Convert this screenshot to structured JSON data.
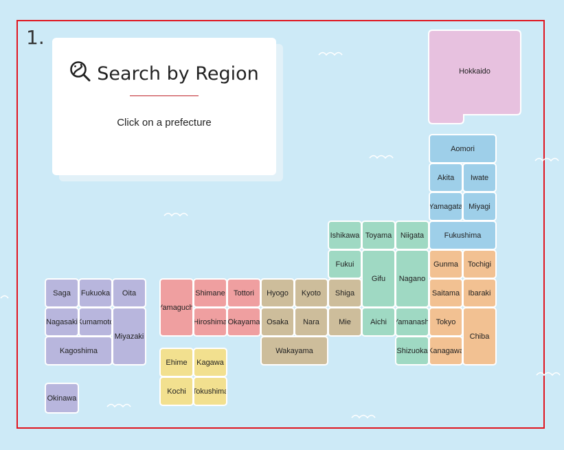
{
  "step_label": "1.",
  "card": {
    "title": "Search by Region",
    "subtitle": "Click on a prefecture",
    "icon": "magnifier-japan-icon"
  },
  "colors": {
    "sea": "#cdeaf7",
    "frame": "#e0141e",
    "hokkaido": "#e7c1df",
    "tohoku": "#9ecfe9",
    "chubu": "#9fd9c3",
    "kanto": "#f2c192",
    "kinki": "#cdbd9b",
    "chugoku": "#ef9fa0",
    "shikoku": "#f2e08f",
    "kyushu": "#b8b6dd"
  },
  "prefectures": {
    "hokkaido": "Hokkaido",
    "aomori": "Aomori",
    "akita": "Akita",
    "iwate": "Iwate",
    "yamagata": "Yamagata",
    "miyagi": "Miyagi",
    "fukushima": "Fukushima",
    "ishikawa": "Ishikawa",
    "toyama": "Toyama",
    "niigata": "Niigata",
    "fukui": "Fukui",
    "gifu": "Gifu",
    "nagano": "Nagano",
    "aichi": "Aichi",
    "yamanashi": "Yamanashi",
    "shizuoka": "Shizuoka",
    "gunma": "Gunma",
    "tochigi": "Tochigi",
    "saitama": "Saitama",
    "ibaraki": "Ibaraki",
    "tokyo": "Tokyo",
    "chiba": "Chiba",
    "kanagawa": "Kanagawa",
    "hyogo": "Hyogo",
    "kyoto": "Kyoto",
    "shiga": "Shiga",
    "osaka": "Osaka",
    "nara": "Nara",
    "mie": "Mie",
    "wakayama": "Wakayama",
    "yamaguchi": "Yamaguchi",
    "shimane": "Shimane",
    "tottori": "Tottori",
    "hiroshima": "Hiroshima",
    "okayama": "Okayama",
    "ehime": "Ehime",
    "kagawa": "Kagawa",
    "kochi": "Kochi",
    "tokushima": "Tokushima",
    "saga": "Saga",
    "fukuoka": "Fukuoka",
    "oita": "Oita",
    "nagasaki": "Nagasaki",
    "kumamoto": "Kumamoto",
    "miyazaki": "Miyazaki",
    "kagoshima": "Kagoshima",
    "okinawa": "Okinawa"
  }
}
